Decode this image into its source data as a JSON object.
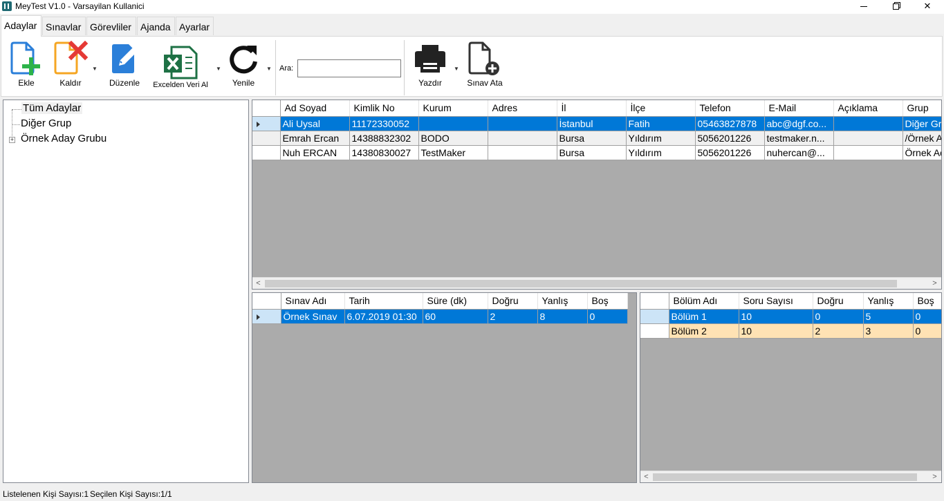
{
  "window": {
    "title": "MeyTest V1.0 - Varsayilan Kullanici",
    "min_glyph": "",
    "close_glyph": "✕"
  },
  "tabs": [
    {
      "label": "Adaylar",
      "active": true
    },
    {
      "label": "Sınavlar"
    },
    {
      "label": "Görevliler"
    },
    {
      "label": "Ajanda"
    },
    {
      "label": "Ayarlar"
    }
  ],
  "toolbar": {
    "add_label": "Ekle",
    "remove_label": "Kaldır",
    "edit_label": "Düzenle",
    "import_excel_label": "Excelden Veri Al",
    "refresh_label": "Yenile",
    "search_label": "Ara:",
    "search_value": "",
    "print_label": "Yazdır",
    "assign_exam_label": "Sınav Ata",
    "dropdown_glyph": "▼",
    "icons": {
      "add": "add-document-icon",
      "remove": "remove-document-icon",
      "edit": "edit-document-icon",
      "excel": "excel-icon",
      "refresh": "refresh-icon",
      "print": "printer-icon",
      "assign": "assign-exam-icon"
    }
  },
  "tree": {
    "items": [
      {
        "label": "Tüm Adaylar",
        "selected": true
      },
      {
        "label": "Diğer Grup"
      },
      {
        "label": "Örnek Aday Grubu",
        "expandable": true
      }
    ],
    "expander_glyph": "+"
  },
  "candidates_grid": {
    "columns": [
      "Ad Soyad",
      "Kimlik No",
      "Kurum",
      "Adres",
      "İl",
      "İlçe",
      "Telefon",
      "E-Mail",
      "Açıklama",
      "Grup"
    ],
    "rows": [
      [
        "Ali Uysal",
        "11172330052",
        "",
        "",
        "İstanbul",
        "Fatih",
        "05463827878",
        "abc@dgf.co...",
        "",
        "Diğer Grup"
      ],
      [
        "Emrah Ercan",
        "14388832302",
        "BODO",
        "",
        "Bursa",
        "Yıldırım",
        "5056201226",
        "testmaker.n...",
        "",
        "/Örnek Aday Grubu"
      ],
      [
        "Nuh ERCAN",
        "14380830027",
        "TestMaker",
        "",
        "Bursa",
        "Yıldırım",
        "5056201226",
        "nuhercan@...",
        "",
        "Örnek Aday Grubu"
      ]
    ]
  },
  "exams_grid": {
    "columns": [
      "Sınav Adı",
      "Tarih",
      "Süre (dk)",
      "Doğru",
      "Yanlış",
      "Boş"
    ],
    "rows": [
      [
        "Örnek Sınav",
        "6.07.2019 01:30",
        "60",
        "2",
        "8",
        "0"
      ]
    ]
  },
  "sections_grid": {
    "columns": [
      "Bölüm Adı",
      "Soru Sayısı",
      "Doğru",
      "Yanlış",
      "Boş"
    ],
    "rows": [
      [
        "Bölüm 1",
        "10",
        "0",
        "5",
        "0"
      ],
      [
        "Bölüm 2",
        "10",
        "2",
        "3",
        "0"
      ]
    ]
  },
  "scroll": {
    "left": "<",
    "right": ">"
  },
  "status": {
    "listed": "Listelenen Kişi Sayısı:1",
    "selected": "Seçilen Kişi Sayısı:1/1"
  },
  "colors": {
    "selection": "#0078d7",
    "peach_row": "#ffe2b4",
    "grid_bg": "#ababab",
    "add_green": "#2db34a",
    "remove_red": "#e53935",
    "orange": "#f5a623",
    "blue": "#2b7fd9",
    "excel_green": "#1e7145"
  }
}
